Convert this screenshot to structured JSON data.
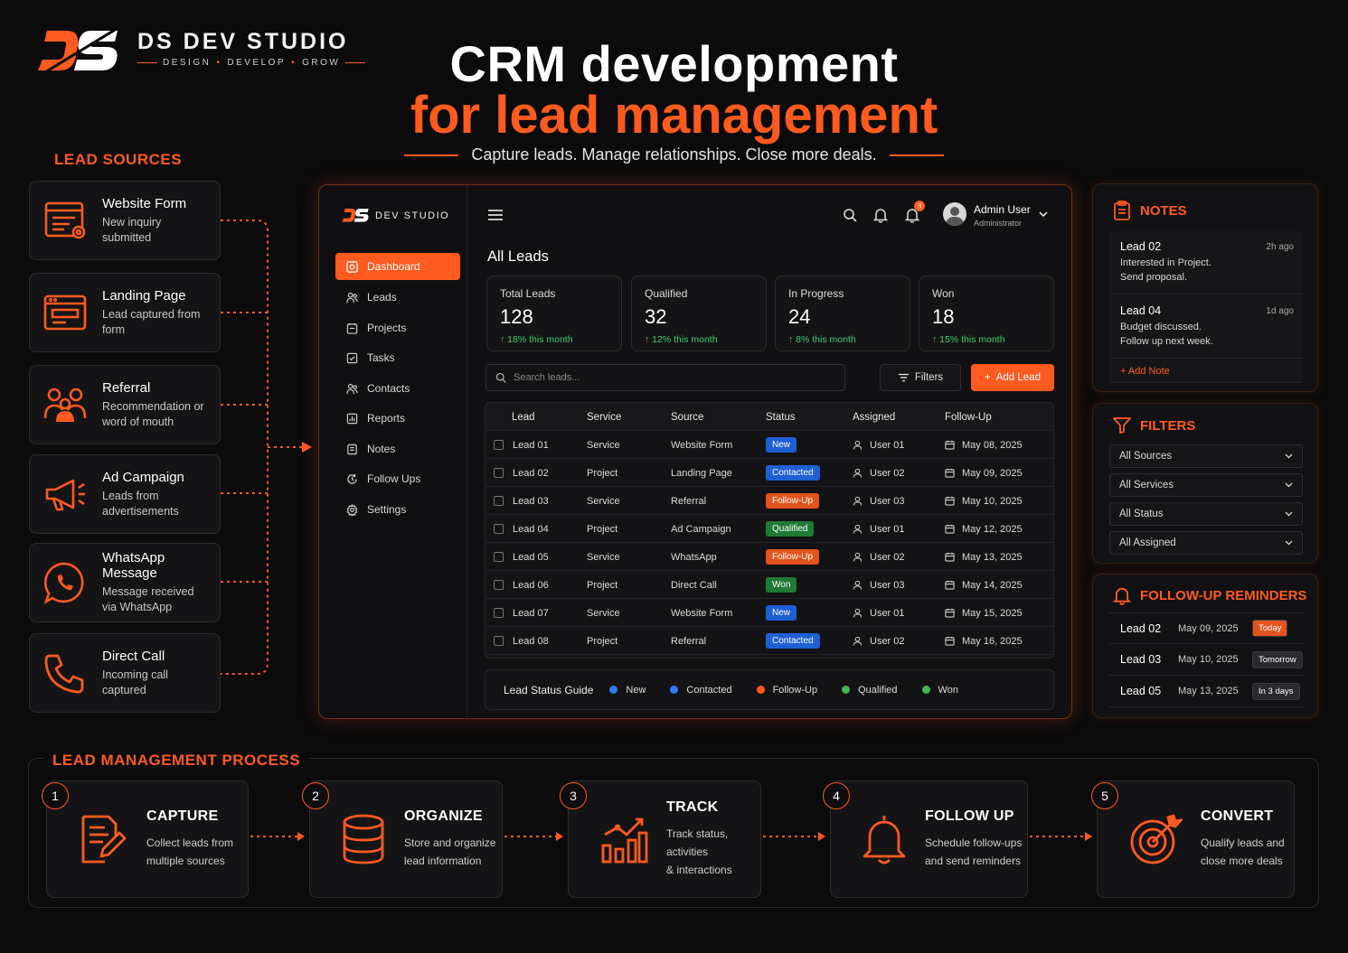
{
  "brand": {
    "name": "DS DEV STUDIO",
    "tagline": [
      "DESIGN",
      "DEVELOP",
      "GROW"
    ],
    "logo_text": "DS",
    "small_logo_name": "DEV STUDIO"
  },
  "hero": {
    "title_line1": "CRM development",
    "title_line2": "for lead management",
    "subtitle": "Capture leads. Manage relationships. Close more deals."
  },
  "lead_sources": {
    "title": "LEAD SOURCES",
    "items": [
      {
        "title": "Website Form",
        "sub": "New inquiry submitted",
        "icon": "web-form-icon"
      },
      {
        "title": "Landing Page",
        "sub": "Lead captured from form",
        "icon": "landing-page-icon"
      },
      {
        "title": "Referral",
        "sub": "Recommendation or word of mouth",
        "icon": "people-icon"
      },
      {
        "title": "Ad Campaign",
        "sub": "Leads from advertisements",
        "icon": "megaphone-icon"
      },
      {
        "title": "WhatsApp Message",
        "sub": "Message received via WhatsApp",
        "icon": "whatsapp-icon"
      },
      {
        "title": "Direct Call",
        "sub": "Incoming call captured",
        "icon": "phone-icon"
      }
    ]
  },
  "dashboard": {
    "nav": [
      {
        "label": "Dashboard",
        "icon": "home-icon",
        "active": true
      },
      {
        "label": "Leads",
        "icon": "users-icon"
      },
      {
        "label": "Projects",
        "icon": "projects-icon"
      },
      {
        "label": "Tasks",
        "icon": "check-icon"
      },
      {
        "label": "Contacts",
        "icon": "contacts-icon"
      },
      {
        "label": "Reports",
        "icon": "reports-icon"
      },
      {
        "label": "Notes",
        "icon": "notes-icon"
      },
      {
        "label": "Follow Ups",
        "icon": "followup-icon"
      },
      {
        "label": "Settings",
        "icon": "gear-icon"
      }
    ],
    "notification_count": "3",
    "user": {
      "name": "Admin User",
      "role": "Administrator"
    },
    "page_title": "All Leads",
    "kpis": [
      {
        "label": "Total Leads",
        "value": "128",
        "delta": "18% this month"
      },
      {
        "label": "Qualified",
        "value": "32",
        "delta": "12% this month"
      },
      {
        "label": "In Progress",
        "value": "24",
        "delta": "8% this month"
      },
      {
        "label": "Won",
        "value": "18",
        "delta": "15% this month"
      }
    ],
    "search_placeholder": "Search leads...",
    "filters_label": "Filters",
    "add_lead_label": "Add Lead",
    "table": {
      "columns": [
        "Lead",
        "Service",
        "Source",
        "Status",
        "Assigned",
        "Follow-Up"
      ],
      "rows": [
        {
          "lead": "Lead 01",
          "service": "Service",
          "source": "Website Form",
          "status": "New",
          "assigned": "User 01",
          "followup": "May 08, 2025"
        },
        {
          "lead": "Lead 02",
          "service": "Project",
          "source": "Landing Page",
          "status": "Contacted",
          "assigned": "User 02",
          "followup": "May 09, 2025"
        },
        {
          "lead": "Lead 03",
          "service": "Service",
          "source": "Referral",
          "status": "Follow-Up",
          "assigned": "User 03",
          "followup": "May 10, 2025"
        },
        {
          "lead": "Lead 04",
          "service": "Project",
          "source": "Ad Campaign",
          "status": "Qualified",
          "assigned": "User 01",
          "followup": "May 12, 2025"
        },
        {
          "lead": "Lead 05",
          "service": "Service",
          "source": "WhatsApp",
          "status": "Follow-Up",
          "assigned": "User 02",
          "followup": "May 13, 2025"
        },
        {
          "lead": "Lead 06",
          "service": "Project",
          "source": "Direct Call",
          "status": "Won",
          "assigned": "User 03",
          "followup": "May 14, 2025"
        },
        {
          "lead": "Lead 07",
          "service": "Service",
          "source": "Website Form",
          "status": "New",
          "assigned": "User 01",
          "followup": "May 15, 2025"
        },
        {
          "lead": "Lead 08",
          "service": "Project",
          "source": "Referral",
          "status": "Contacted",
          "assigned": "User 02",
          "followup": "May 16, 2025"
        }
      ]
    },
    "status_guide": {
      "label": "Lead Status Guide",
      "items": [
        {
          "label": "New",
          "color": "#2f7bf5"
        },
        {
          "label": "Contacted",
          "color": "#2f7bf5"
        },
        {
          "label": "Follow-Up",
          "color": "#ff5a1f"
        },
        {
          "label": "Qualified",
          "color": "#3fb950"
        },
        {
          "label": "Won",
          "color": "#3fb950"
        }
      ]
    },
    "status_colors": {
      "New": "#1f5fd6",
      "Contacted": "#1f5fd6",
      "Follow-Up": "#e2541c",
      "Qualified": "#1f7a36",
      "Won": "#1f7a36"
    }
  },
  "notes": {
    "title": "NOTES",
    "items": [
      {
        "lead": "Lead 02",
        "ago": "2h ago",
        "text1": "Interested in Project.",
        "text2": "Send proposal."
      },
      {
        "lead": "Lead 04",
        "ago": "1d ago",
        "text1": "Budget discussed.",
        "text2": "Follow up next week."
      }
    ],
    "add_label": "+ Add Note"
  },
  "filters": {
    "title": "FILTERS",
    "selects": [
      "All Sources",
      "All Services",
      "All Status",
      "All Assigned"
    ]
  },
  "reminders": {
    "title": "FOLLOW-UP REMINDERS",
    "items": [
      {
        "lead": "Lead 02",
        "date": "May 09, 2025",
        "tag": "Today",
        "tag_color": "#e2541c"
      },
      {
        "lead": "Lead 03",
        "date": "May 10, 2025",
        "tag": "Tomorrow",
        "tag_color": "#2a2a2e"
      },
      {
        "lead": "Lead 05",
        "date": "May 13, 2025",
        "tag": "In 3 days",
        "tag_color": "#2a2a2e"
      }
    ]
  },
  "process": {
    "title": "LEAD MANAGEMENT PROCESS",
    "steps": [
      {
        "num": "1",
        "title": "CAPTURE",
        "sub1": "Collect leads from",
        "sub2": "multiple sources",
        "icon": "capture-icon"
      },
      {
        "num": "2",
        "title": "ORGANIZE",
        "sub1": "Store and organize",
        "sub2": "lead information",
        "icon": "database-icon"
      },
      {
        "num": "3",
        "title": "TRACK",
        "sub1": "Track status, activities",
        "sub2": "& interactions",
        "icon": "chart-icon"
      },
      {
        "num": "4",
        "title": "FOLLOW UP",
        "sub1": "Schedule follow-ups",
        "sub2": "and send reminders",
        "icon": "bell-icon"
      },
      {
        "num": "5",
        "title": "CONVERT",
        "sub1": "Qualify leads and",
        "sub2": "close more deals",
        "icon": "target-icon"
      }
    ]
  },
  "colors": {
    "accent": "#ff5a1f",
    "background": "#0b0b0c",
    "positive": "#3ecf6e"
  }
}
